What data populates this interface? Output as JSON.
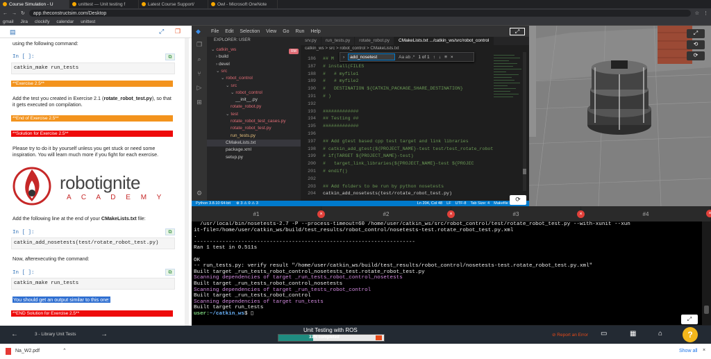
{
  "browser": {
    "tabs": [
      {
        "label": "Course Simulation - U",
        "active": true
      },
      {
        "label": "unittest — Unit testing f",
        "active": false
      },
      {
        "label": "Latest Course Support/",
        "active": false
      },
      {
        "label": "Owl - Microsoft OneNote",
        "active": false
      }
    ],
    "url": "app.theconstructsim.com/Desktop",
    "bookmarks": [
      "gmail",
      "Jira",
      "clockify",
      "calendar",
      "unittest"
    ]
  },
  "notebook": {
    "intro": "using the following command:",
    "in1": "In [ ]:",
    "code1": "catkin_make run_tests",
    "exercise_label": "**Exercise 2.5**",
    "exercise_text_a": "Add the test you created in Exercise 2.1 (",
    "exercise_text_bold": "rotate_robot_test.py",
    "exercise_text_b": "), so that it gets executed on compilation.",
    "end_exercise": "**End of Exercise 2.5**",
    "solution": "**Solution for Exercise 2.5**",
    "advice": "Please try to do it by yourself unless you get stuck or need some inspiration. You will learn much more if you fight for each exercise.",
    "logo_word": "robotignite",
    "logo_sub": "A C A D E M Y",
    "add_line_a": "Add the following line at the end of your ",
    "add_line_bold": "CMakeLists.txt",
    "add_line_b": " file:",
    "in2": "In [ ]:",
    "code2": "catkin_add_nosetests(test/rotate_robot_test.py)",
    "now_exec": "Now, afterexecuting the command:",
    "in3": "In [ ]:",
    "code3": "catkin_make run_tests",
    "output_note": "You should get an output similar to this one:",
    "end_solution": "**END Solution for Exercise 2.5**"
  },
  "vscode": {
    "menu": [
      "File",
      "Edit",
      "Selection",
      "View",
      "Go",
      "Run",
      "Help"
    ],
    "explorer_title": "EXPLORER: USER",
    "tree": [
      {
        "label": "catkin_ws",
        "depth": 0,
        "color": "#e06c75",
        "arrow": "v"
      },
      {
        "label": "build",
        "depth": 1,
        "color": "#cccccc",
        "arrow": ">"
      },
      {
        "label": "devel",
        "depth": 1,
        "color": "#cccccc",
        "arrow": ">"
      },
      {
        "label": "src",
        "depth": 1,
        "color": "#e06c75",
        "arrow": "v"
      },
      {
        "label": "robot_control",
        "depth": 2,
        "color": "#e06c75",
        "arrow": "v"
      },
      {
        "label": "src",
        "depth": 3,
        "color": "#e06c75",
        "arrow": "v"
      },
      {
        "label": "robot_control",
        "depth": 4,
        "color": "#e06c75",
        "arrow": "v"
      },
      {
        "label": "__init__.py",
        "depth": 5,
        "color": "#cccccc",
        "arrow": ""
      },
      {
        "label": "rotate_robot.py",
        "depth": 4,
        "color": "#e06c75",
        "arrow": ""
      },
      {
        "label": "test",
        "depth": 3,
        "color": "#e06c75",
        "arrow": "v"
      },
      {
        "label": "rotate_robot_test_cases.py",
        "depth": 4,
        "color": "#e06c75",
        "arrow": ""
      },
      {
        "label": "rotate_robot_test.py",
        "depth": 4,
        "color": "#e06c75",
        "arrow": ""
      },
      {
        "label": "run_tests.py",
        "depth": 4,
        "color": "#e5c07b",
        "arrow": ""
      },
      {
        "label": "CMakeLists.txt",
        "depth": 3,
        "color": "#cccccc",
        "arrow": ""
      },
      {
        "label": "package.xml",
        "depth": 3,
        "color": "#cccccc",
        "arrow": ""
      },
      {
        "label": "setup.py",
        "depth": 3,
        "color": "#cccccc",
        "arrow": ""
      }
    ],
    "editor_tabs": [
      "srv.py",
      "run_tests.py",
      "rotate_robot.py",
      "CMakeLists.txt .../catkin_ws/src/robot_control"
    ],
    "breadcrumbs": "catkin_ws  >  src  >  robot_control  >  CMakeLists.txt",
    "find_query": "add_nosetest",
    "find_opts": "Aa  ab  .*",
    "find_count": "1 of 1",
    "code_lines": [
      {
        "n": "186",
        "t": "## M",
        "c": "#6a9955"
      },
      {
        "n": "187",
        "t": "# install(FILES",
        "c": "#6a9955"
      },
      {
        "n": "188",
        "t": "#   # myfile1",
        "c": "#6a9955"
      },
      {
        "n": "189",
        "t": "#   # myfile2",
        "c": "#6a9955"
      },
      {
        "n": "190",
        "t": "#   DESTINATION ${CATKIN_PACKAGE_SHARE_DESTINATION}",
        "c": "#6a9955"
      },
      {
        "n": "191",
        "t": "# )",
        "c": "#6a9955"
      },
      {
        "n": "192",
        "t": "",
        "c": "#6a9955"
      },
      {
        "n": "193",
        "t": "#############",
        "c": "#6a9955"
      },
      {
        "n": "194",
        "t": "## Testing ##",
        "c": "#6a9955"
      },
      {
        "n": "195",
        "t": "#############",
        "c": "#6a9955"
      },
      {
        "n": "196",
        "t": "",
        "c": "#6a9955"
      },
      {
        "n": "197",
        "t": "## Add gtest based cpp test target and link libraries",
        "c": "#6a9955"
      },
      {
        "n": "198",
        "t": "# catkin_add_gtest(${PROJECT_NAME}-test test/test_rotate_robot",
        "c": "#6a9955"
      },
      {
        "n": "199",
        "t": "# if(TARGET ${PROJECT_NAME}-test)",
        "c": "#6a9955"
      },
      {
        "n": "200",
        "t": "#   target_link_libraries(${PROJECT_NAME}-test ${PROJEC",
        "c": "#6a9955"
      },
      {
        "n": "201",
        "t": "# endif()",
        "c": "#6a9955"
      },
      {
        "n": "202",
        "t": "",
        "c": "#6a9955"
      },
      {
        "n": "203",
        "t": "## Add folders to be run by python nosetests",
        "c": "#6a9955"
      },
      {
        "n": "204",
        "t": "catkin_add_nosetests(test/rotate_robot_test.py)",
        "c": "#d4d4d4"
      }
    ],
    "status_left": "Python 3.8.10 64-bit",
    "status_errors": "⊗ 3  ⚠ 0  ⚠ 3",
    "status_right": [
      "Ln 204, Col 48",
      "LF",
      "UTF-8",
      "Tab Size: 4",
      "Makefile"
    ]
  },
  "terminal": {
    "tabs": [
      "#1",
      "#2",
      "#3",
      "#4"
    ],
    "lines": [
      {
        "t": "  /usr/local/bin/nosetests-2.7 -P --process-timeout=60 /home/user/catkin_ws/src/robot_control/test/rotate_robot_test.py --with-xunit --xun",
        "k": ""
      },
      {
        "t": "it-file=/home/user/catkin_ws/build/test_results/robot_control/nosetests-test.rotate_robot_test.py.xml",
        "k": ""
      },
      {
        "t": ".",
        "k": ""
      },
      {
        "t": "----------------------------------------------------------------------",
        "k": ""
      },
      {
        "t": "Ran 1 test in 0.511s",
        "k": ""
      },
      {
        "t": "",
        "k": ""
      },
      {
        "t": "OK",
        "k": ""
      },
      {
        "t": "-- run_tests.py: verify result \"/home/user/catkin_ws/build/test_results/robot_control/nosetests-test.rotate_robot_test.py.xml\"",
        "k": ""
      },
      {
        "t": "Built target _run_tests_robot_control_nosetests_test.rotate_robot_test.py",
        "k": ""
      },
      {
        "t": "Scanning dependencies of target _run_tests_robot_control_nosetests",
        "k": "mag"
      },
      {
        "t": "Built target _run_tests_robot_control_nosetests",
        "k": ""
      },
      {
        "t": "Scanning dependencies of target _run_tests_robot_control",
        "k": "mag"
      },
      {
        "t": "Built target _run_tests_robot_control",
        "k": ""
      },
      {
        "t": "Scanning dependencies of target run_tests",
        "k": "mag"
      },
      {
        "t": "Built target run_tests",
        "k": ""
      }
    ],
    "prompt_user": "user:",
    "prompt_path": "~/catkin_ws",
    "prompt_sym": "$"
  },
  "bottom": {
    "unit": "3 - Library Unit Tests",
    "course_title": "Unit Testing with ROS",
    "progress_label": "33% completed",
    "progress": 0.33,
    "report": "Report an Error",
    "help": "?"
  },
  "download": {
    "file": "Na_W2.pdf",
    "show_all": "Show all"
  }
}
